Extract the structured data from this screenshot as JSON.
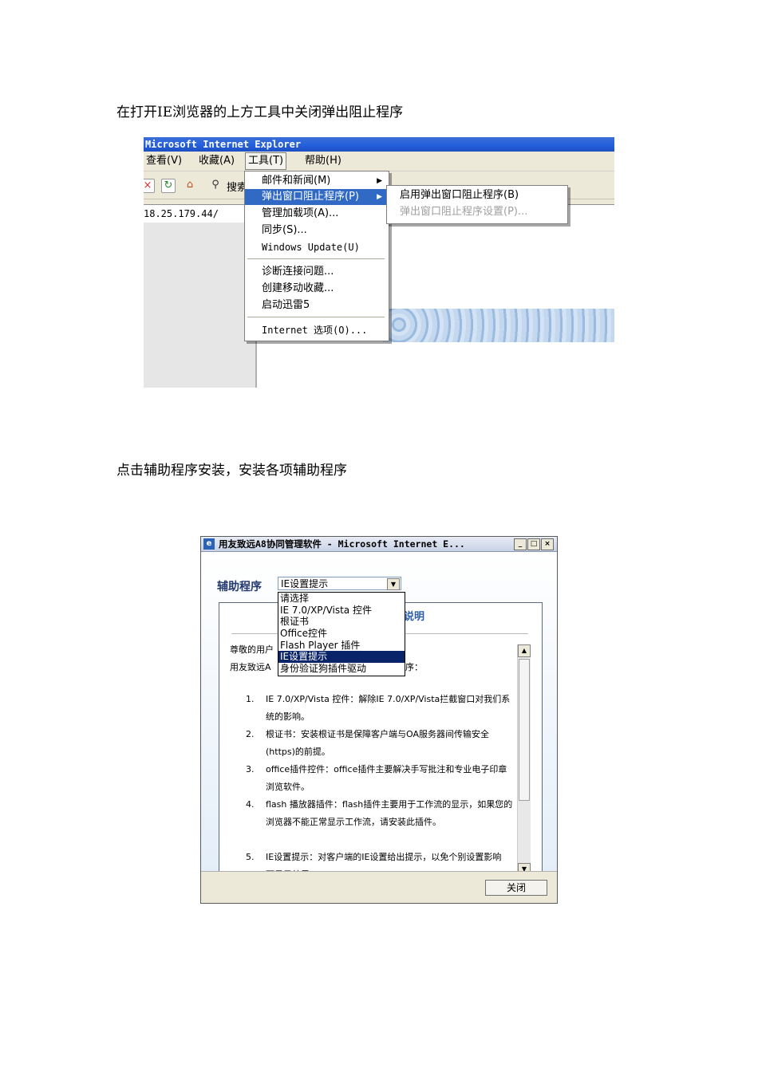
{
  "instruction1": "在打开IE浏览器的上方工具中关闭弹出阻止程序",
  "instruction2": "点击辅助程序安装，安装各项辅助程序",
  "screenshot1": {
    "title": "Microsoft Internet Explorer",
    "menubar": [
      "查看(V)",
      "收藏(A)",
      "工具(T)",
      "帮助(H)"
    ],
    "search_label": "搜索",
    "address": "18.25.179.44/",
    "tools_menu": {
      "items": [
        "邮件和新闻(M)",
        "弹出窗口阻止程序(P)",
        "管理加载项(A)...",
        "同步(S)...",
        "Windows Update(U)",
        "诊断连接问题...",
        "创建移动收藏...",
        "启动迅雷5",
        "Internet 选项(O)..."
      ],
      "highlighted": "弹出窗口阻止程序(P)"
    },
    "submenu": [
      "启用弹出窗口阻止程序(B)",
      "弹出窗口阻止程序设置(P)..."
    ]
  },
  "screenshot2": {
    "title": "用友致远A8协同管理软件 - Microsoft Internet E...",
    "label": "辅助程序",
    "selected": "IE设置提示",
    "options": [
      "请选择",
      "IE 7.0/XP/Vista 控件",
      "根证书",
      "Office控件",
      "Flash Player 插件",
      "IE设置提示",
      "身份验证狗插件驱动"
    ],
    "heading_fragment": "说明",
    "greeting_fragment": "尊敬的用户",
    "intro_left": "用友致远A",
    "intro_right": "助程序：",
    "list": [
      {
        "num": "1.",
        "text": "IE 7.0/XP/Vista 控件：解除IE 7.0/XP/Vista拦截窗口对我们系统的影响。"
      },
      {
        "num": "2.",
        "text": "根证书：安装根证书是保障客户端与OA服务器间传输安全(https)的前提。"
      },
      {
        "num": "3.",
        "text": "office插件控件：office插件主要解决手写批注和专业电子印章浏览软件。"
      },
      {
        "num": "4.",
        "text": "flash 播放器插件：flash插件主要用于工作流的显示，如果您的浏览器不能正常显示工作流，请安装此插件。"
      },
      {
        "num": "5.",
        "text": "IE设置提示：对客户端的IE设置给出提示，以免个别设置影响页面显示效果"
      }
    ],
    "close_label": "关闭"
  }
}
